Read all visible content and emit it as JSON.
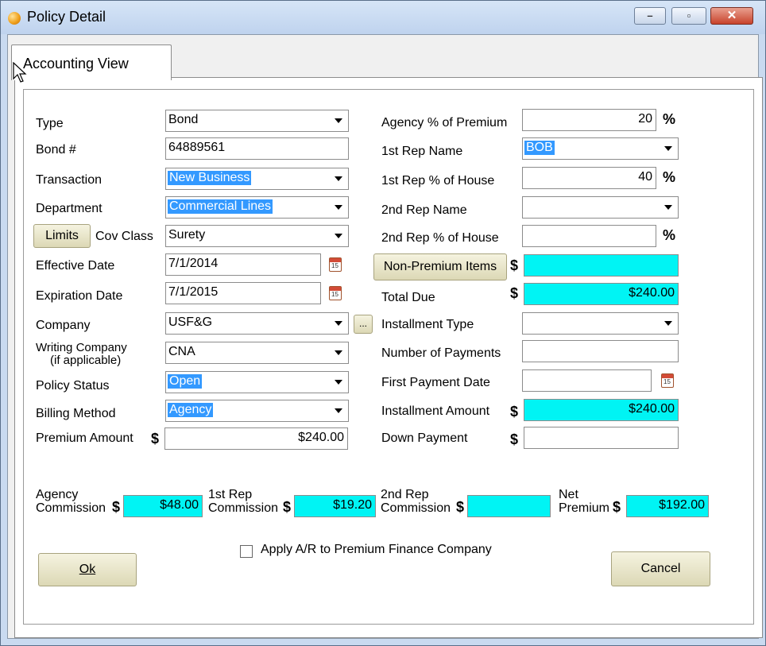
{
  "window": {
    "title": "Policy Detail",
    "minimize": "–",
    "maximize": "▫",
    "close": "✕"
  },
  "tab": {
    "label": "Accounting View"
  },
  "left_form": {
    "type": {
      "label": "Type",
      "value": "Bond"
    },
    "bond_no": {
      "label": "Bond #",
      "value": "64889561"
    },
    "transaction": {
      "label": "Transaction",
      "value": "New Business"
    },
    "department": {
      "label": "Department",
      "value": "Commercial Lines"
    },
    "limits_button": "Limits",
    "cov_class": {
      "label": "Cov Class",
      "value": "Surety"
    },
    "effective_date": {
      "label": "Effective Date",
      "value": "7/1/2014"
    },
    "expiration_date": {
      "label": "Expiration Date",
      "value": "7/1/2015"
    },
    "company": {
      "label": "Company",
      "value": "USF&G"
    },
    "company_browse": "...",
    "writing_company": {
      "label_line1": "Writing Company",
      "label_line2": "(if applicable)",
      "value": "CNA"
    },
    "policy_status": {
      "label": "Policy Status",
      "value": "Open"
    },
    "billing_method": {
      "label": "Billing Method",
      "value": "Agency"
    },
    "premium_amount": {
      "label": "Premium Amount",
      "value": "$240.00"
    }
  },
  "right_form": {
    "agency_pct": {
      "label": "Agency % of Premium",
      "value": "20",
      "unit": "%"
    },
    "rep1_name": {
      "label": "1st Rep Name",
      "value": "BOB"
    },
    "rep1_pct": {
      "label": "1st Rep % of House",
      "value": "40",
      "unit": "%"
    },
    "rep2_name": {
      "label": "2nd Rep Name",
      "value": ""
    },
    "rep2_pct": {
      "label": "2nd Rep % of House",
      "value": "",
      "unit": "%"
    },
    "non_premium_button": "Non-Premium Items",
    "non_premium_value": "",
    "total_due": {
      "label": "Total Due",
      "value": "$240.00"
    },
    "installment_type": {
      "label": "Installment Type",
      "value": ""
    },
    "num_payments": {
      "label": "Number of Payments",
      "value": ""
    },
    "first_payment_date": {
      "label": "First Payment Date",
      "value": ""
    },
    "installment_amount": {
      "label": "Installment Amount",
      "value": "$240.00"
    },
    "down_payment": {
      "label": "Down Payment",
      "value": ""
    }
  },
  "commissions": {
    "agency": {
      "label_line1": "Agency",
      "label_line2": "Commission",
      "value": "$48.00"
    },
    "rep1": {
      "label_line1": "1st Rep",
      "label_line2": "Commission",
      "value": "$19.20"
    },
    "rep2": {
      "label_line1": "2nd Rep",
      "label_line2": "Commission",
      "value": ""
    },
    "net": {
      "label_line1": "Net",
      "label_line2": "Premium",
      "value": "$192.00"
    }
  },
  "currency_symbol": "$",
  "calendar_day": "15",
  "apply_ar": {
    "label": "Apply A/R to Premium Finance Company",
    "checked": false
  },
  "buttons": {
    "ok": "Ok",
    "cancel": "Cancel"
  },
  "colors": {
    "highlight": "#00f4f4",
    "selection": "#3399ff",
    "button_face": "#e8e4c8"
  }
}
